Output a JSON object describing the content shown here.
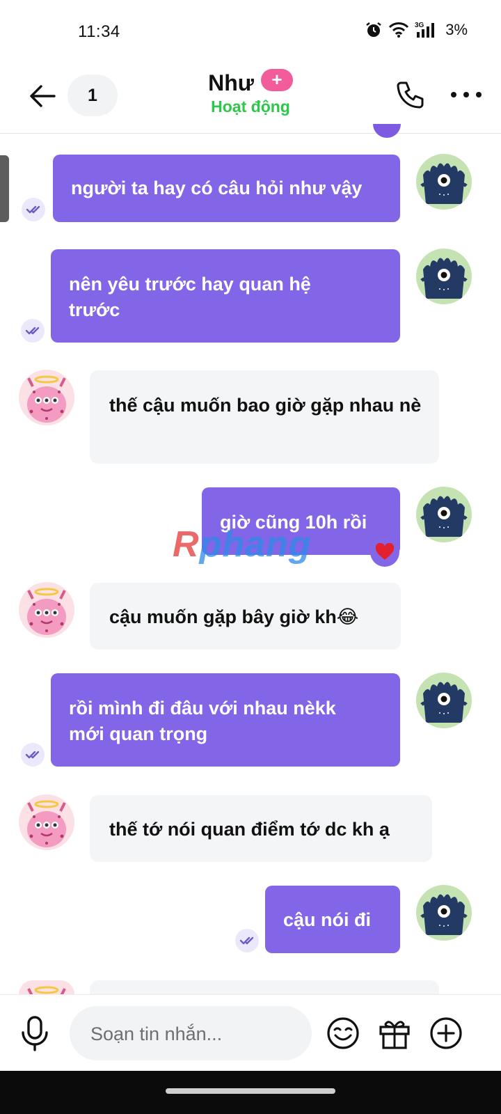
{
  "status_bar": {
    "time": "11:34",
    "network": "3G",
    "battery": "3%"
  },
  "header": {
    "unread_count": "1",
    "contact_name": "Như",
    "badge": "+",
    "contact_status": "Hoạt động"
  },
  "messages": [
    {
      "sender": "me",
      "text": "người ta hay có câu hỏi như vậy",
      "seen": true
    },
    {
      "sender": "me",
      "text": "nên yêu trước hay quan hệ trước",
      "seen": true
    },
    {
      "sender": "them",
      "text": "thế cậu muốn bao giờ gặp nhau nè"
    },
    {
      "sender": "me",
      "text": "giờ cũng 10h rồi",
      "reaction": "heart"
    },
    {
      "sender": "them",
      "text": "cậu muốn gặp bây giờ kh😂"
    },
    {
      "sender": "me",
      "text": "rồi mình đi đâu với nhau nèkk mới quan trọng",
      "seen": true
    },
    {
      "sender": "them",
      "text": "thế tớ nói quan điểm tớ dc kh ạ"
    },
    {
      "sender": "me",
      "text": "cậu nói đi",
      "seen": true
    }
  ],
  "watermark": {
    "part1": "R",
    "part2": "phang"
  },
  "composer": {
    "placeholder": "Soạn tin nhắn..."
  },
  "colors": {
    "my_bubble": "#8365e8",
    "their_bubble": "#f4f5f7",
    "status_online": "#2dc74a",
    "badge": "#f25c9a"
  },
  "icons": [
    "back-arrow-icon",
    "phone-icon",
    "more-icon",
    "double-check-icon",
    "heart-icon",
    "mic-icon",
    "emoji-icon",
    "gift-icon",
    "add-icon"
  ]
}
